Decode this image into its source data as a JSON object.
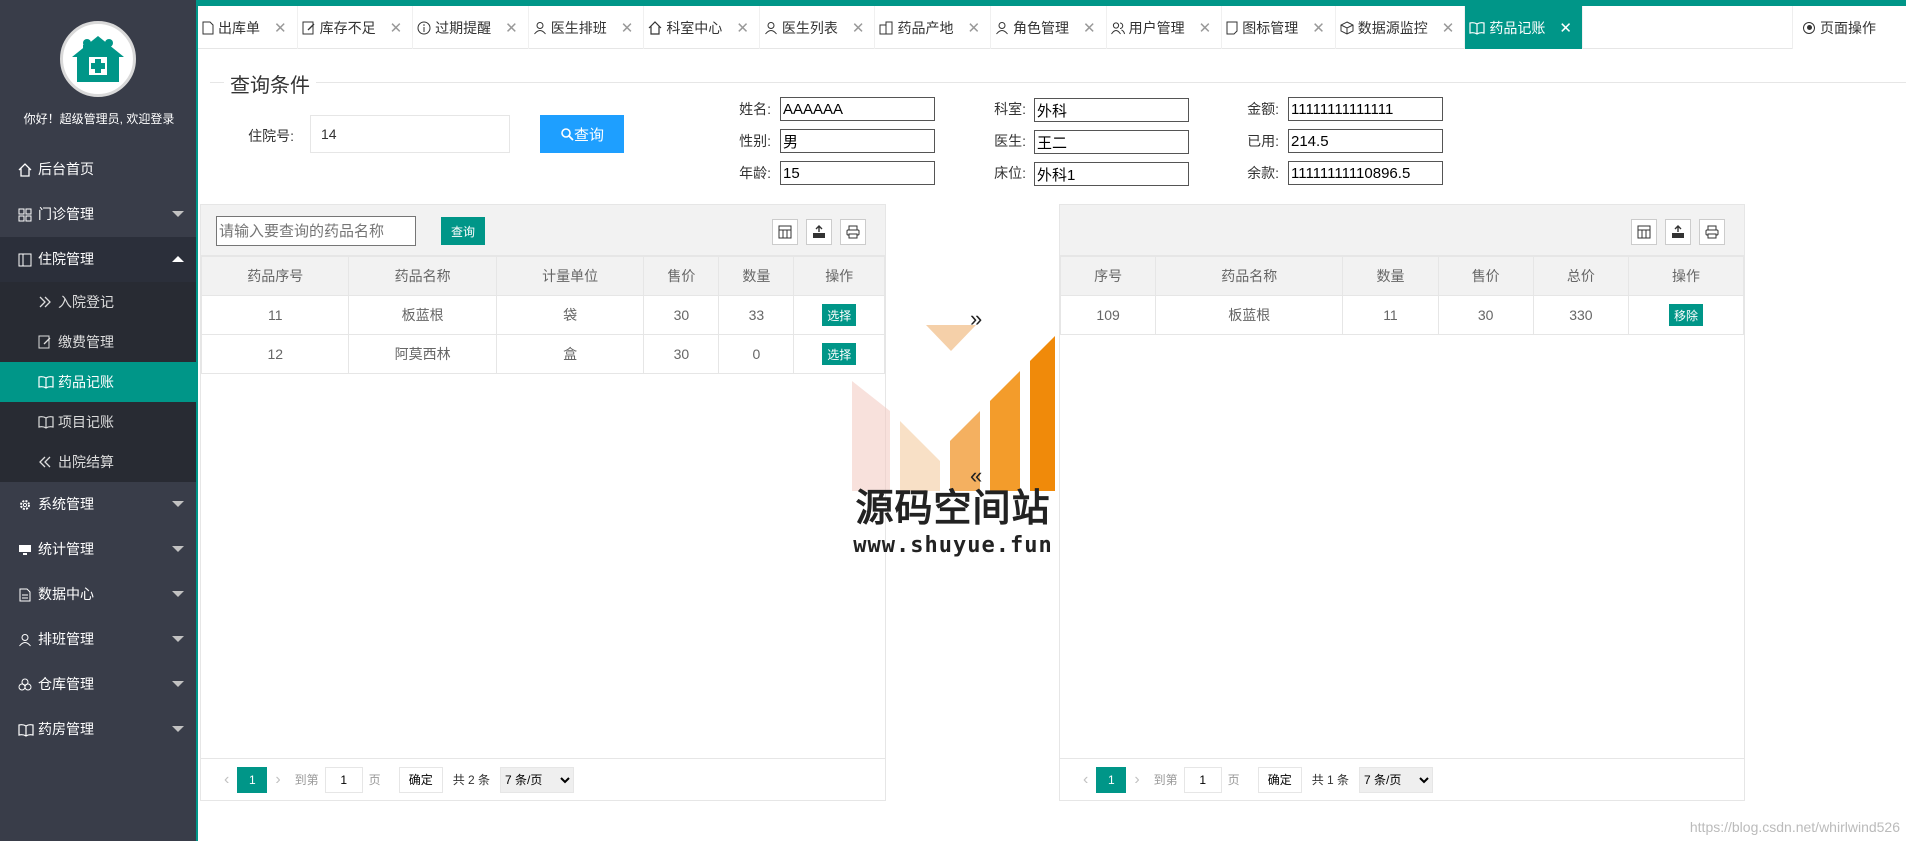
{
  "colors": {
    "accent": "#009688",
    "sidebar_bg": "#393d49",
    "blue_button": "#1e9fff"
  },
  "sidebar": {
    "welcome": "你好！超级管理员, 欢迎登录",
    "items": [
      {
        "label": "后台首页",
        "icon": "home-icon"
      },
      {
        "label": "门诊管理",
        "icon": "grid-icon"
      },
      {
        "label": "住院管理",
        "icon": "columns-icon"
      },
      {
        "label": "系统管理",
        "icon": "gear-icon"
      },
      {
        "label": "统计管理",
        "icon": "monitor-icon"
      },
      {
        "label": "数据中心",
        "icon": "document-icon"
      },
      {
        "label": "排班管理",
        "icon": "user-icon"
      },
      {
        "label": "仓库管理",
        "icon": "app-store-icon"
      },
      {
        "label": "药房管理",
        "icon": "book-icon"
      }
    ],
    "sub_items": [
      {
        "label": "入院登记",
        "icon": "double-chevron-right-icon"
      },
      {
        "label": "缴费管理",
        "icon": "edit-icon"
      },
      {
        "label": "药品记账",
        "icon": "book-icon"
      },
      {
        "label": "项目记账",
        "icon": "book-icon"
      },
      {
        "label": "出院结算",
        "icon": "double-chevron-left-icon"
      }
    ]
  },
  "tabs": [
    {
      "label": "出库单",
      "icon": "file-icon"
    },
    {
      "label": "库存不足",
      "icon": "edit-icon"
    },
    {
      "label": "过期提醒",
      "icon": "info-icon"
    },
    {
      "label": "医生排班",
      "icon": "user-icon"
    },
    {
      "label": "科室中心",
      "icon": "home-icon"
    },
    {
      "label": "医生列表",
      "icon": "user-icon"
    },
    {
      "label": "药品产地",
      "icon": "building-icon"
    },
    {
      "label": "角色管理",
      "icon": "user-icon"
    },
    {
      "label": "用户管理",
      "icon": "users-icon"
    },
    {
      "label": "图标管理",
      "icon": "note-icon"
    },
    {
      "label": "数据源监控",
      "icon": "cube-icon"
    },
    {
      "label": "药品记账",
      "icon": "book-icon"
    }
  ],
  "close_glyph": "✕",
  "page_ops": "页面操作",
  "query": {
    "legend": "查询条件",
    "admission_label": "住院号:",
    "admission_value": "14",
    "button": "查询"
  },
  "patient": {
    "name_label": "姓名:",
    "name": "AAAAAA",
    "gender_label": "性别:",
    "gender": "男",
    "age_label": "年龄:",
    "age": "15",
    "dept_label": "科室:",
    "dept": "外科",
    "doctor_label": "医生:",
    "doctor": "王二",
    "bed_label": "床位:",
    "bed": "外科1",
    "amount_label": "金额:",
    "amount": "11111111111111",
    "used_label": "已用:",
    "used": "214.5",
    "balance_label": "余款:",
    "balance": "11111111110896.5"
  },
  "left_panel": {
    "search_placeholder": "请输入要查询的药品名称",
    "search_button": "查询",
    "columns": [
      "药品序号",
      "药品名称",
      "计量单位",
      "售价",
      "数量",
      "操作"
    ],
    "rows": [
      {
        "id": "11",
        "name": "板蓝根",
        "unit": "袋",
        "price": "30",
        "qty": "33",
        "action": "选择"
      },
      {
        "id": "12",
        "name": "阿莫西林",
        "unit": "盒",
        "price": "30",
        "qty": "0",
        "action": "选择"
      }
    ],
    "pager": {
      "current": "1",
      "goto": "到第",
      "page_value": "1",
      "page_unit": "页",
      "ok": "确定",
      "total": "共 2 条",
      "per_page": "7 条/页"
    }
  },
  "right_panel": {
    "columns": [
      "序号",
      "药品名称",
      "数量",
      "售价",
      "总价",
      "操作"
    ],
    "rows": [
      {
        "id": "109",
        "name": "板蓝根",
        "qty": "11",
        "price": "30",
        "total": "330",
        "action": "移除"
      }
    ],
    "pager": {
      "current": "1",
      "goto": "到第",
      "page_value": "1",
      "page_unit": "页",
      "ok": "确定",
      "total": "共 1 条",
      "per_page": "7 条/页"
    }
  },
  "middle": {
    "move_right": "»",
    "move_left": "«"
  },
  "watermark": {
    "title": "源码空间站",
    "url": "www.shuyue.fun"
  },
  "footer_url": "https://blog.csdn.net/whirlwind526"
}
